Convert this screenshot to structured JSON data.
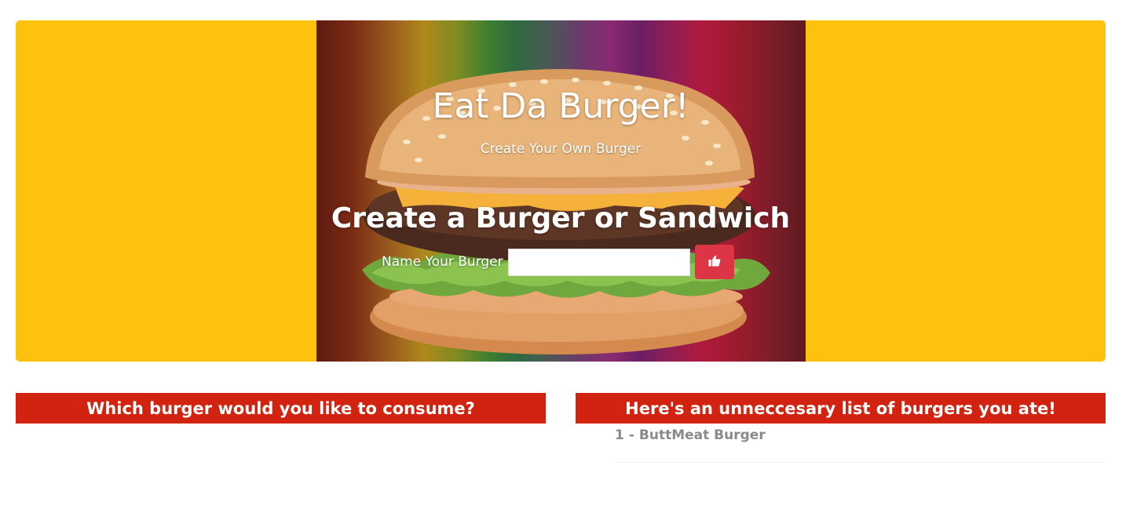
{
  "hero": {
    "title": "Eat Da Burger!",
    "subtitle": "Create Your Own Burger",
    "form_heading": "Create a Burger or Sandwich",
    "form": {
      "label": "Name Your Burger",
      "input_value": "",
      "input_placeholder": "",
      "submit_icon": "thumbs-up-icon"
    },
    "background_image": "burger-photo"
  },
  "uneaten_panel": {
    "header": "Which burger would you like to consume?",
    "items": []
  },
  "eaten_panel": {
    "header": "Here's an unneccesary list of burgers you ate!",
    "items": [
      {
        "id": "1",
        "name": "ButtMeat Burger"
      }
    ]
  },
  "colors": {
    "hero_background": "#fdc20e",
    "header_background": "#d1230f",
    "button": "#dc3545",
    "eaten_text": "#8a8a8a"
  }
}
